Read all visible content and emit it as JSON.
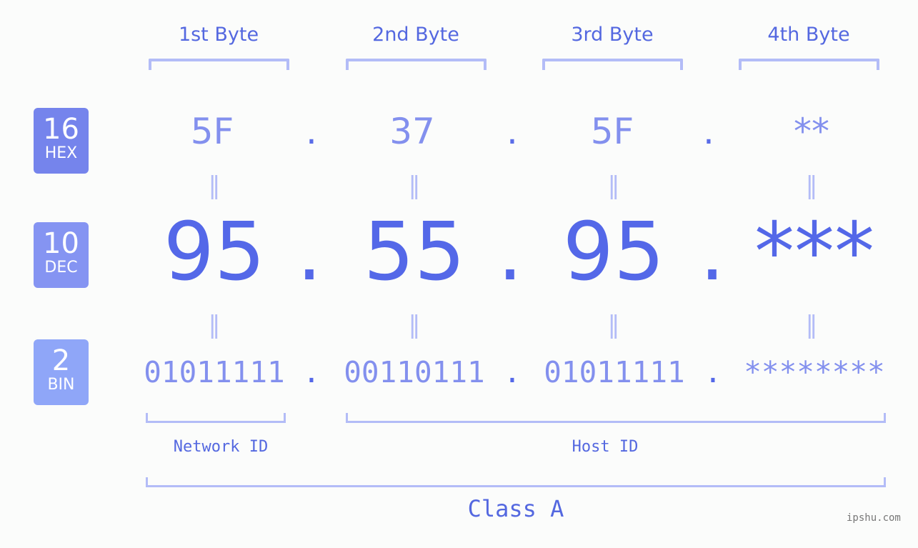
{
  "headers": [
    "1st Byte",
    "2nd Byte",
    "3rd Byte",
    "4th Byte"
  ],
  "badges": [
    {
      "num": "16",
      "label": "HEX",
      "color": "#7584ec"
    },
    {
      "num": "10",
      "label": "DEC",
      "color": "#8594f2"
    },
    {
      "num": "2",
      "label": "BIN",
      "color": "#8fa6f8"
    }
  ],
  "hex": [
    "5F",
    "37",
    "5F",
    "**"
  ],
  "dec": [
    "95",
    "55",
    "95",
    "***"
  ],
  "bin": [
    "01011111",
    "00110111",
    "01011111",
    "********"
  ],
  "separator": ".",
  "equals": "=",
  "network_label": "Network ID",
  "host_label": "Host ID",
  "class_label": "Class A",
  "watermark": "ipshu.com",
  "colors": {
    "accent": "#5468e8",
    "light": "#b3bcf7",
    "mid": "#8390ee"
  }
}
